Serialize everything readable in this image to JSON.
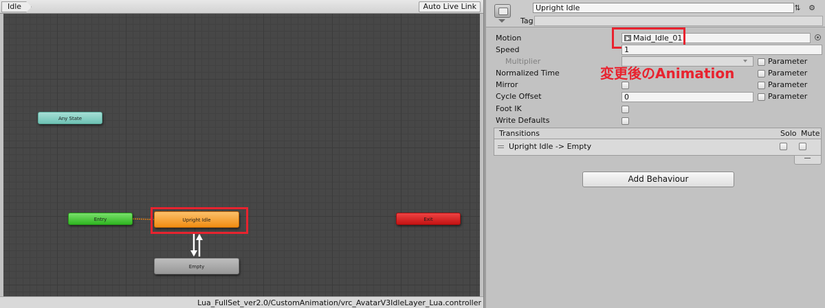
{
  "animator": {
    "breadcrumb": "Idle",
    "auto_live_link": "Auto Live Link",
    "asset_path": "Lua_FullSet_ver2.0/CustomAnimation/vrc_AvatarV3IdleLayer_Lua.controller",
    "nodes": {
      "any_state": "Any State",
      "entry": "Entry",
      "exit": "Exit",
      "upright_idle": "Upright Idle",
      "empty": "Empty"
    },
    "highlight_color": "#e8232f",
    "node_colors": {
      "any_state": "#6ec2b4",
      "entry": "#2fb521",
      "exit": "#c41313",
      "upright_idle": "#f18c12",
      "empty": "#989898"
    }
  },
  "inspector": {
    "state_name": "Upright Idle",
    "tag_label": "Tag",
    "header_icons": "⇅ ⚙",
    "motion_label": "Motion",
    "motion_value": "Maid_Idle_01",
    "speed_label": "Speed",
    "speed_value": "1",
    "multiplier_label": "Multiplier",
    "normalized_time_label": "Normalized Time",
    "mirror_label": "Mirror",
    "cycle_offset_label": "Cycle Offset",
    "cycle_offset_value": "0",
    "foot_ik_label": "Foot IK",
    "write_defaults_label": "Write Defaults",
    "parameter_label": "Parameter",
    "annotation": "変更後のAnimation",
    "transitions": {
      "title": "Transitions",
      "solo": "Solo",
      "mute": "Mute",
      "items": [
        "Upright Idle -> Empty"
      ]
    },
    "add_behaviour": "Add Behaviour"
  }
}
